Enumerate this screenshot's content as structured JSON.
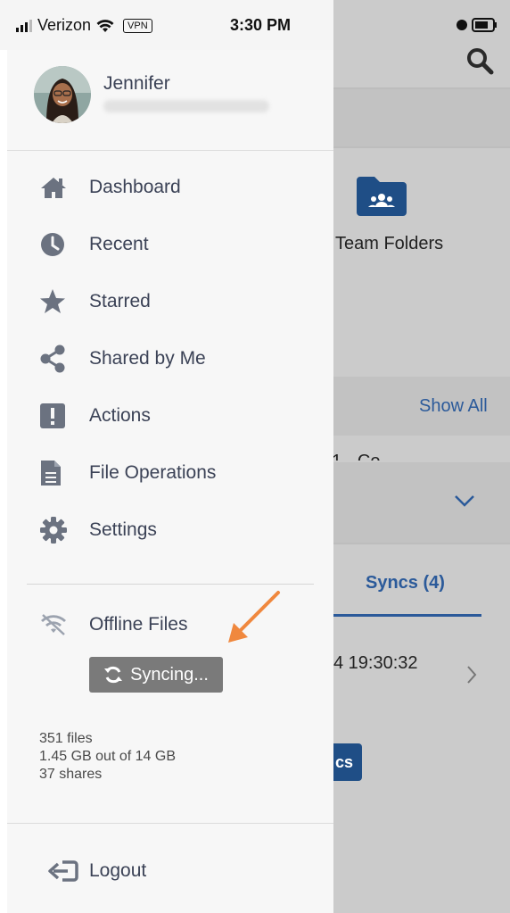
{
  "status_bar": {
    "carrier": "Verizon",
    "vpn": "VPN",
    "time": "3:30 PM"
  },
  "drawer": {
    "user": {
      "name": "Jennifer"
    },
    "menu": [
      {
        "label": "Dashboard",
        "icon": "home-icon"
      },
      {
        "label": "Recent",
        "icon": "clock-icon"
      },
      {
        "label": "Starred",
        "icon": "star-icon"
      },
      {
        "label": "Shared by Me",
        "icon": "share-icon"
      },
      {
        "label": "Actions",
        "icon": "exclamation-icon"
      },
      {
        "label": "File Operations",
        "icon": "document-icon"
      },
      {
        "label": "Settings",
        "icon": "gear-icon"
      }
    ],
    "offline": {
      "label": "Offline Files",
      "icon": "wifi-off-icon"
    },
    "syncing_button": "Syncing...",
    "stats": {
      "files": "351 files",
      "storage": "1.45 GB out of 14 GB",
      "shares": "37 shares"
    },
    "logout": "Logout"
  },
  "background": {
    "team_folders": "Team Folders",
    "show_all": "Show All",
    "partial_row": "1 - Co",
    "syncs_tab": "Syncs (4)",
    "sync_time": "4 19:30:32",
    "button_fragment": "cs"
  },
  "colors": {
    "accent": "#2b5a9a",
    "drawer_bg": "#f7f7f7",
    "overlay": "#cbcbcb",
    "icon": "#6b7280",
    "annotation_arrow": "#f0883e"
  }
}
